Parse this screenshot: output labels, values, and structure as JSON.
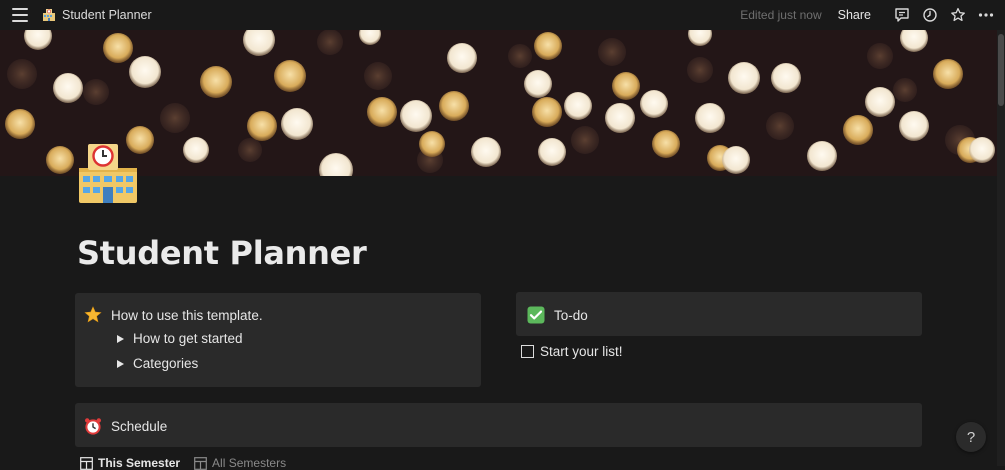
{
  "topbar": {
    "page_name": "Student Planner",
    "edited_text": "Edited just now",
    "share_label": "Share"
  },
  "page": {
    "title": "Student Planner",
    "icon": "school-building-icon",
    "cover": "bokeh-lights-cover"
  },
  "how_to_callout": {
    "icon": "star-icon",
    "heading": "How to use this template.",
    "toggles": [
      {
        "label": "How to get started"
      },
      {
        "label": "Categories"
      }
    ]
  },
  "todo_callout": {
    "icon": "check-mark-button-icon",
    "heading": "To-do",
    "items": [
      {
        "label": "Start your list!",
        "checked": false
      }
    ]
  },
  "schedule_callout": {
    "icon": "alarm-clock-icon",
    "heading": "Schedule"
  },
  "views": [
    {
      "label": "This Semester",
      "active": true
    },
    {
      "label": "All Semesters",
      "active": false
    }
  ],
  "help_label": "?",
  "colors": {
    "background": "#191919",
    "callout_bg": "#2a2a2a",
    "text": "#e6e6e6",
    "muted": "#6f6f6f",
    "todo_green": "#5cb85c"
  }
}
